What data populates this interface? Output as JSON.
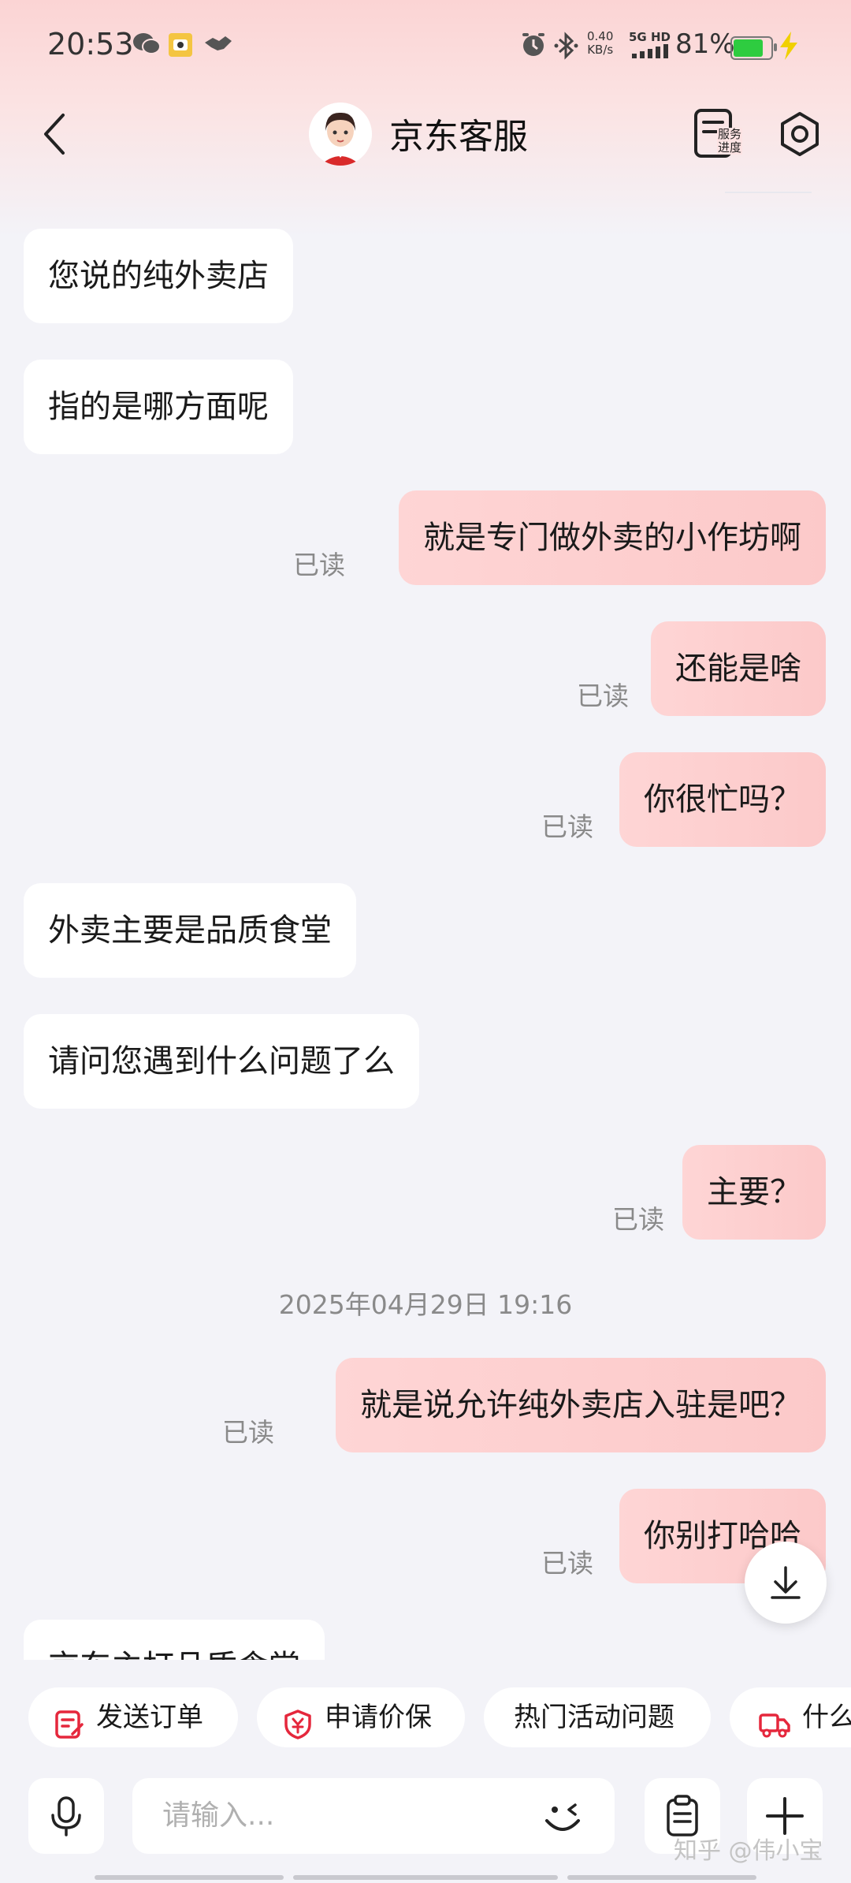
{
  "status_bar": {
    "time": "20:53",
    "net_speed": "0.40",
    "net_unit": "KB/s",
    "signal": "5G HD",
    "battery_pct": "81%",
    "battery_level": 0.81,
    "icons": [
      "wechat-icon",
      "app-notification-icon",
      "handshake-icon",
      "alarm-icon",
      "bluetooth-icon",
      "signal-icon",
      "battery-icon",
      "charging-icon"
    ]
  },
  "header": {
    "title": "京东客服",
    "service_label_line1": "服务",
    "service_label_line2": "进度",
    "icons": [
      "back-icon",
      "avatar",
      "service-progress-icon",
      "settings-icon"
    ]
  },
  "messages": [
    {
      "side": "in",
      "text": "您说的纯外卖店"
    },
    {
      "side": "in",
      "text": "指的是哪方面呢"
    },
    {
      "side": "out",
      "text": "就是专门做外卖的小作坊啊",
      "status": "已读"
    },
    {
      "side": "out",
      "text": "还能是啥",
      "status": "已读"
    },
    {
      "side": "out",
      "text": "你很忙吗？",
      "status": "已读"
    },
    {
      "side": "in",
      "text": "外卖主要是品质食堂"
    },
    {
      "side": "in",
      "text": "请问您遇到什么问题了么"
    },
    {
      "side": "out",
      "text": "主要？",
      "status": "已读"
    },
    {
      "side": "out",
      "text": "就是说允许纯外卖店入驻是吧？",
      "status": "已读"
    },
    {
      "side": "out",
      "text": "你别打哈哈",
      "status": "已读"
    },
    {
      "side": "in",
      "text": "京东主打品质食堂"
    }
  ],
  "timestamp": "2025年04月29日 19:16",
  "quick_actions": [
    {
      "label": "发送订单",
      "icon": "order-icon"
    },
    {
      "label": "申请价保",
      "icon": "price-protect-icon"
    },
    {
      "label": "热门活动问题",
      "icon": ""
    },
    {
      "label": "什么",
      "icon": "delivery-truck-icon"
    }
  ],
  "input": {
    "placeholder": "请输入...",
    "icons": [
      "microphone-icon",
      "emoji-icon",
      "clipboard-icon",
      "plus-icon"
    ]
  },
  "watermark": "知乎 @伟小宝",
  "colors": {
    "accent": "#e5273c",
    "outgoing_bubble": "#fccccc",
    "incoming_bubble": "#ffffff",
    "background": "#f3f3f8"
  }
}
